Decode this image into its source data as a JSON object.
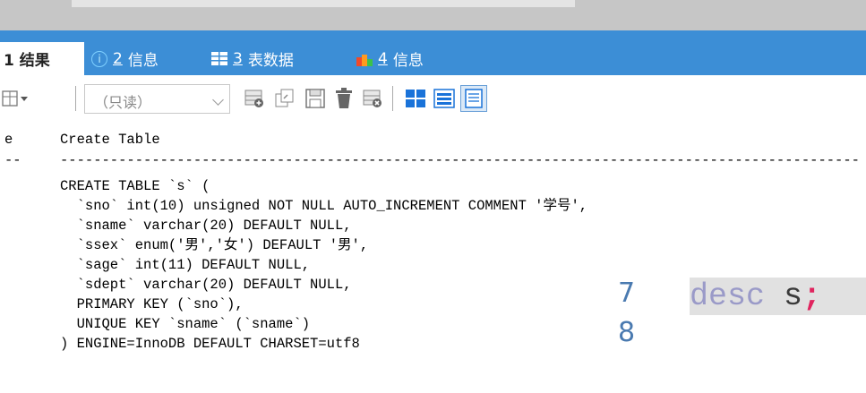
{
  "tabs": [
    {
      "label": "1 结果"
    },
    {
      "num": "2",
      "label": "信息",
      "icon": "info-icon"
    },
    {
      "num": "3",
      "label": "表数据",
      "icon": "table-grid-icon"
    },
    {
      "num": "4",
      "label": "信息",
      "icon": "colorful-info-icon"
    }
  ],
  "toolbar": {
    "mode_select": "（只读）"
  },
  "result": {
    "col1_header": "e",
    "col2_header": "Create Table",
    "col1_dash": "--",
    "col2_dash": "------------------------------------------------------------------------------------------------",
    "lines": [
      "CREATE TABLE `s` (",
      "  `sno` int(10) unsigned NOT NULL AUTO_INCREMENT COMMENT '学号',",
      "  `sname` varchar(20) DEFAULT NULL,",
      "  `ssex` enum('男','女') DEFAULT '男',",
      "  `sage` int(11) DEFAULT NULL,",
      "  `sdept` varchar(20) DEFAULT NULL,",
      "  PRIMARY KEY (`sno`),",
      "  UNIQUE KEY `sname` (`sname`)",
      ") ENGINE=InnoDB DEFAULT CHARSET=utf8"
    ]
  },
  "editor_overlay": {
    "line7": "7",
    "line8": "8",
    "keyword": "desc",
    "identifier": "s",
    "semicolon": ";"
  },
  "colors": {
    "tabbar": "#3c8ed6",
    "line_numbers": "#4a7ab0",
    "semicolon": "#e0245e"
  }
}
